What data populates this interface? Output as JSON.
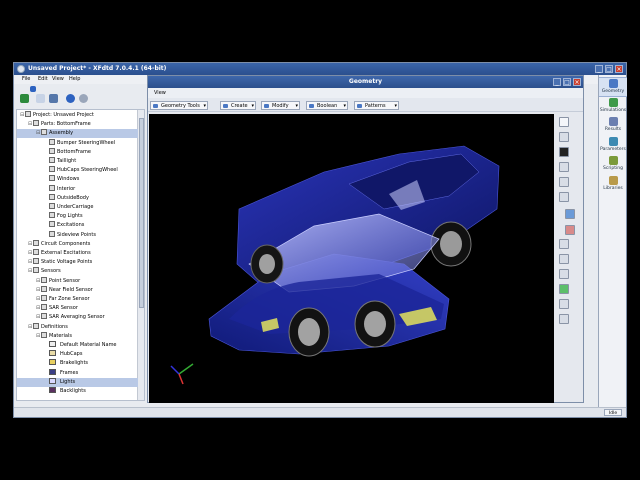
{
  "window": {
    "title": "Unsaved Project* - XFdtd 7.0.4.1 (64-bit)",
    "buttons": {
      "minimize": "_",
      "maximize": "□",
      "close": "×"
    }
  },
  "menu": [
    "File",
    "Edit",
    "View",
    "Help"
  ],
  "tree": {
    "rows": [
      {
        "text": "Project: Unsaved Project",
        "indent": 0,
        "icon": "project-icon"
      },
      {
        "text": "Parts: BottomFrame",
        "indent": 1,
        "icon": "parts-icon"
      },
      {
        "text": "Assembly",
        "indent": 2,
        "icon": "assembly-icon",
        "selected": true
      },
      {
        "text": "Bumper SteeringWheel",
        "indent": 3,
        "icon": "part-icon"
      },
      {
        "text": "BottomFrame",
        "indent": 3,
        "icon": "part-icon"
      },
      {
        "text": "Taillight",
        "indent": 3,
        "icon": "part-icon"
      },
      {
        "text": "HubCaps SteeringWheel",
        "indent": 3,
        "icon": "part-icon"
      },
      {
        "text": "Windows",
        "indent": 3,
        "icon": "part-icon"
      },
      {
        "text": "Interior",
        "indent": 3,
        "icon": "part-icon"
      },
      {
        "text": "OutsideBody",
        "indent": 3,
        "icon": "part-icon"
      },
      {
        "text": "UnderCarriage",
        "indent": 3,
        "icon": "part-icon"
      },
      {
        "text": "Fog Lights",
        "indent": 3,
        "icon": "part-icon"
      },
      {
        "text": "Excitations",
        "indent": 3,
        "icon": "part-icon"
      },
      {
        "text": "Sideview Points",
        "indent": 3,
        "icon": "part-icon"
      },
      {
        "text": "Circuit Components",
        "indent": 1,
        "icon": "circuit-icon"
      },
      {
        "text": "External Excitations",
        "indent": 1,
        "icon": "excitation-icon"
      },
      {
        "text": "Static Voltage Points",
        "indent": 1,
        "icon": "voltage-icon"
      },
      {
        "text": "Sensors",
        "indent": 1,
        "icon": "sensor-icon"
      },
      {
        "text": "Point Sensor",
        "indent": 2,
        "icon": "sensor-icon"
      },
      {
        "text": "Near Field Sensor",
        "indent": 2,
        "icon": "sensor-icon"
      },
      {
        "text": "Far Zone Sensor",
        "indent": 2,
        "icon": "sensor-icon"
      },
      {
        "text": "SAR Sensor",
        "indent": 2,
        "icon": "sensor-icon"
      },
      {
        "text": "SAR Averaging Sensor",
        "indent": 2,
        "icon": "sensor-icon"
      },
      {
        "text": "Definitions",
        "indent": 1,
        "icon": "definitions-icon"
      },
      {
        "text": "Materials",
        "indent": 2,
        "icon": "materials-icon"
      },
      {
        "text": "Default Material Name",
        "indent": 3,
        "swatch": "#eeeeee"
      },
      {
        "text": "HubCaps",
        "indent": 3,
        "swatch": "#e9dca8"
      },
      {
        "text": "Brakelights",
        "indent": 3,
        "swatch": "#e8d060"
      },
      {
        "text": "Frames",
        "indent": 3,
        "swatch": "#3b3f86"
      },
      {
        "text": "Lights",
        "indent": 3,
        "swatch": "#d9d9ff",
        "selected": true
      },
      {
        "text": "Backlights",
        "indent": 3,
        "swatch": "#5a3060"
      }
    ]
  },
  "geometry": {
    "title": "Geometry",
    "view_menu": "View",
    "toolbar": [
      "Geometry Tools",
      "Create",
      "Modify",
      "Boolean",
      "Patterns"
    ]
  },
  "sidebar": [
    {
      "label": "Geometry",
      "color": "#4a78c4"
    },
    {
      "label": "Simulations",
      "color": "#3f9a4a"
    },
    {
      "label": "Results",
      "color": "#6b7fb0"
    },
    {
      "label": "Parameters",
      "color": "#3d8ab2"
    },
    {
      "label": "Scripting",
      "color": "#7a9a3a"
    },
    {
      "label": "Libraries",
      "color": "#b89a4a"
    }
  ],
  "status": {
    "indicator": "Idle"
  }
}
